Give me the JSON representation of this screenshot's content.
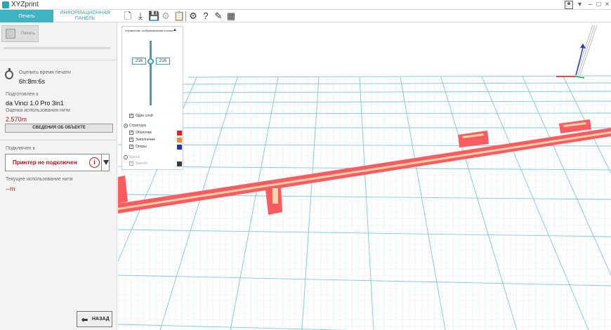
{
  "window": {
    "title": "XYZprint",
    "minimize": "–",
    "maximize": "□",
    "close": "×",
    "user_menu_arrow": "▾"
  },
  "tabs": [
    {
      "label": "Печать"
    },
    {
      "label": "ИНФОРМАЦИОННАЯ ПАНЕЛЬ"
    }
  ],
  "toolbar_icons": [
    "new-file-icon",
    "import-icon",
    "save-icon",
    "convert-icon",
    "clipboard-icon",
    "settings-icon",
    "help-icon",
    "edit-icon",
    "stats-icon"
  ],
  "sidebar": {
    "print_button": "Печать",
    "progress": 0.0,
    "print_time_label": "Оценить время печати",
    "print_time_value": "6h:8m:6s",
    "prepared_for_label": "Подготовлен к",
    "prepared_for_value": "da Vinci 1.0 Pro 3in1",
    "filament_estimate_label": "Оценка использования нити",
    "filament_estimate_value": "2.570m",
    "object_info_button": "СВЕДЕНИЯ ОБ ОБЪЕКТЕ",
    "connected_to_label": "Подключен к",
    "printer_status": "Принтер не подключен",
    "printer_info_icon": "i",
    "current_filament_label": "Текущее использование нити",
    "current_filament_value": "--m",
    "back_button": "НАЗАД"
  },
  "layer_panel": {
    "title": "Управление отображаемыми слоями",
    "collapse_glyph": "▲",
    "layer_from": "216",
    "layer_to": "216",
    "single_layer": {
      "label": "Один слой",
      "checked": true
    },
    "structure": {
      "label": "Структура",
      "selected": true
    },
    "items": [
      {
        "label": "Оболочки",
        "checked": true,
        "color": "#e0202a"
      },
      {
        "label": "Заполнение",
        "checked": true,
        "color": "#ee8a3a"
      },
      {
        "label": "Опоры",
        "checked": true,
        "color": "#1f2fb8"
      }
    ],
    "speed": {
      "label": "Speed",
      "selected": false
    },
    "speed_items": [
      {
        "label": "Speeds",
        "checked": true,
        "color": "#3a3a3a"
      }
    ]
  },
  "colors": {
    "accent": "#3fb3c4",
    "error": "#c0141c",
    "grid": "#7fc6dc",
    "model_outer": "#ff5a60",
    "model_inner": "#f6d6a8"
  }
}
